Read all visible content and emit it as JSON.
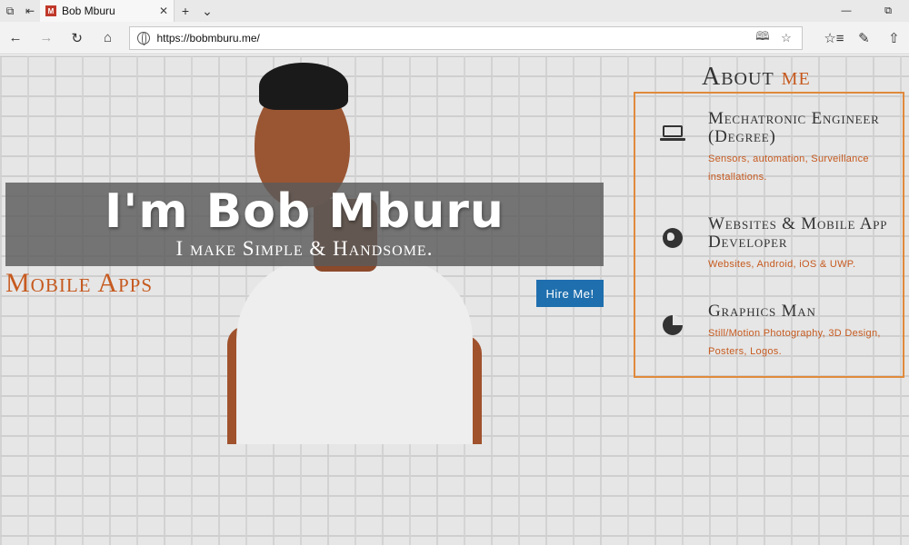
{
  "browser": {
    "tab_title": "Bob Mburu",
    "url": "https://bobmburu.me/",
    "icons": [
      "tab-preview-icon",
      "tabs-aside-icon",
      "close-icon",
      "new-tab-icon",
      "tab-list-chevron-icon",
      "minimize-icon",
      "maximize-icon",
      "back-icon",
      "forward-icon",
      "refresh-icon",
      "home-icon",
      "reading-view-icon",
      "favorite-star-icon",
      "favorites-hub-icon",
      "pen-icon",
      "share-icon"
    ]
  },
  "hero": {
    "name": "I'm Bob Mburu",
    "tagline": "I make Simple & Handsome.",
    "rotating_word": "Mobile Apps",
    "hire_label": "Hire Me!"
  },
  "about": {
    "title_main": "About",
    "title_accent": "me",
    "services": [
      {
        "title": "Mechatronic Engineer (Degree)",
        "desc": "Sensors, automation, Surveillance installations.",
        "icon": "laptop-icon"
      },
      {
        "title": "Websites & Mobile App Developer",
        "desc": "Websites, Android, iOS & UWP.",
        "icon": "globe-icon"
      },
      {
        "title": "Graphics Man",
        "desc": "Still/Motion Photography, 3D Design, Posters, Logos.",
        "icon": "pie-chart-icon"
      }
    ]
  },
  "colors": {
    "accent": "#c65a1f",
    "border": "#e08a3c",
    "button": "#1f6fae",
    "banner": "#5a5a5a"
  }
}
